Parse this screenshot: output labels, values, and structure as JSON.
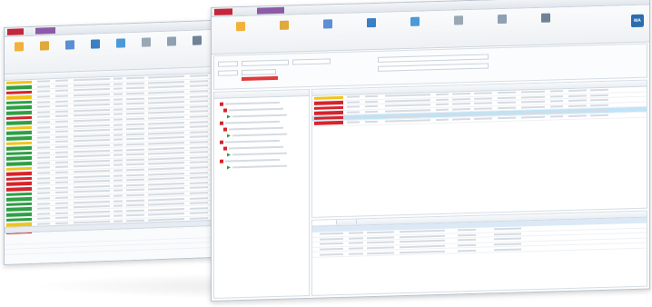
{
  "back_window": {
    "tabs": [
      {
        "label": "",
        "color": "#c4263a"
      },
      {
        "label": "",
        "color": "#8c5aa8"
      }
    ],
    "ribbon_buttons": [
      {
        "icon": "pencil-icon"
      },
      {
        "icon": "folder-icon"
      },
      {
        "icon": "users-icon"
      },
      {
        "icon": "chart-icon"
      },
      {
        "icon": "share-icon"
      },
      {
        "icon": "document-icon"
      },
      {
        "icon": "document-icon"
      },
      {
        "icon": "print-icon"
      }
    ],
    "rows": [
      {
        "status": "yellow"
      },
      {
        "status": "green"
      },
      {
        "status": "red"
      },
      {
        "status": "yellow"
      },
      {
        "status": "green"
      },
      {
        "status": "green"
      },
      {
        "status": "green"
      },
      {
        "status": "red"
      },
      {
        "status": "green"
      },
      {
        "status": "yellow"
      },
      {
        "status": "green"
      },
      {
        "status": "green"
      },
      {
        "status": "yellow"
      },
      {
        "status": "green"
      },
      {
        "status": "green"
      },
      {
        "status": "green"
      },
      {
        "status": "green"
      },
      {
        "status": "yellow"
      },
      {
        "status": "red"
      },
      {
        "status": "red"
      },
      {
        "status": "red"
      },
      {
        "status": "red"
      },
      {
        "status": "green"
      },
      {
        "status": "green"
      },
      {
        "status": "green"
      },
      {
        "status": "green"
      },
      {
        "status": "green"
      },
      {
        "status": "green"
      },
      {
        "status": "yellow"
      },
      {
        "status": "red"
      },
      {
        "status": "red"
      },
      {
        "status": "red"
      }
    ]
  },
  "front_window": {
    "tabs": [
      {
        "label": "",
        "color": "#c4263a"
      },
      {
        "label": "",
        "color": "#8c5aa8"
      }
    ],
    "ribbon_buttons": [
      {
        "icon": "pencil-icon"
      },
      {
        "icon": "folder-icon"
      },
      {
        "icon": "users-icon"
      },
      {
        "icon": "chart-icon"
      },
      {
        "icon": "share-icon"
      },
      {
        "icon": "document-icon"
      },
      {
        "icon": "document-icon"
      },
      {
        "icon": "help-icon"
      }
    ],
    "logo": "MA",
    "list_rows": [
      {
        "status": "yellow"
      },
      {
        "status": "red"
      },
      {
        "status": "red"
      },
      {
        "status": "red"
      },
      {
        "status": "red"
      },
      {
        "status": "red"
      }
    ],
    "tree_items": [
      {
        "type": "red"
      },
      {
        "type": "red"
      },
      {
        "type": "green"
      },
      {
        "type": "red"
      },
      {
        "type": "red"
      },
      {
        "type": "green"
      },
      {
        "type": "red"
      },
      {
        "type": "red"
      },
      {
        "type": "green"
      },
      {
        "type": "red"
      },
      {
        "type": "green"
      }
    ],
    "bottom_tabs": [
      "",
      ""
    ],
    "bottom_rows": [
      {},
      {},
      {},
      {},
      {}
    ]
  }
}
